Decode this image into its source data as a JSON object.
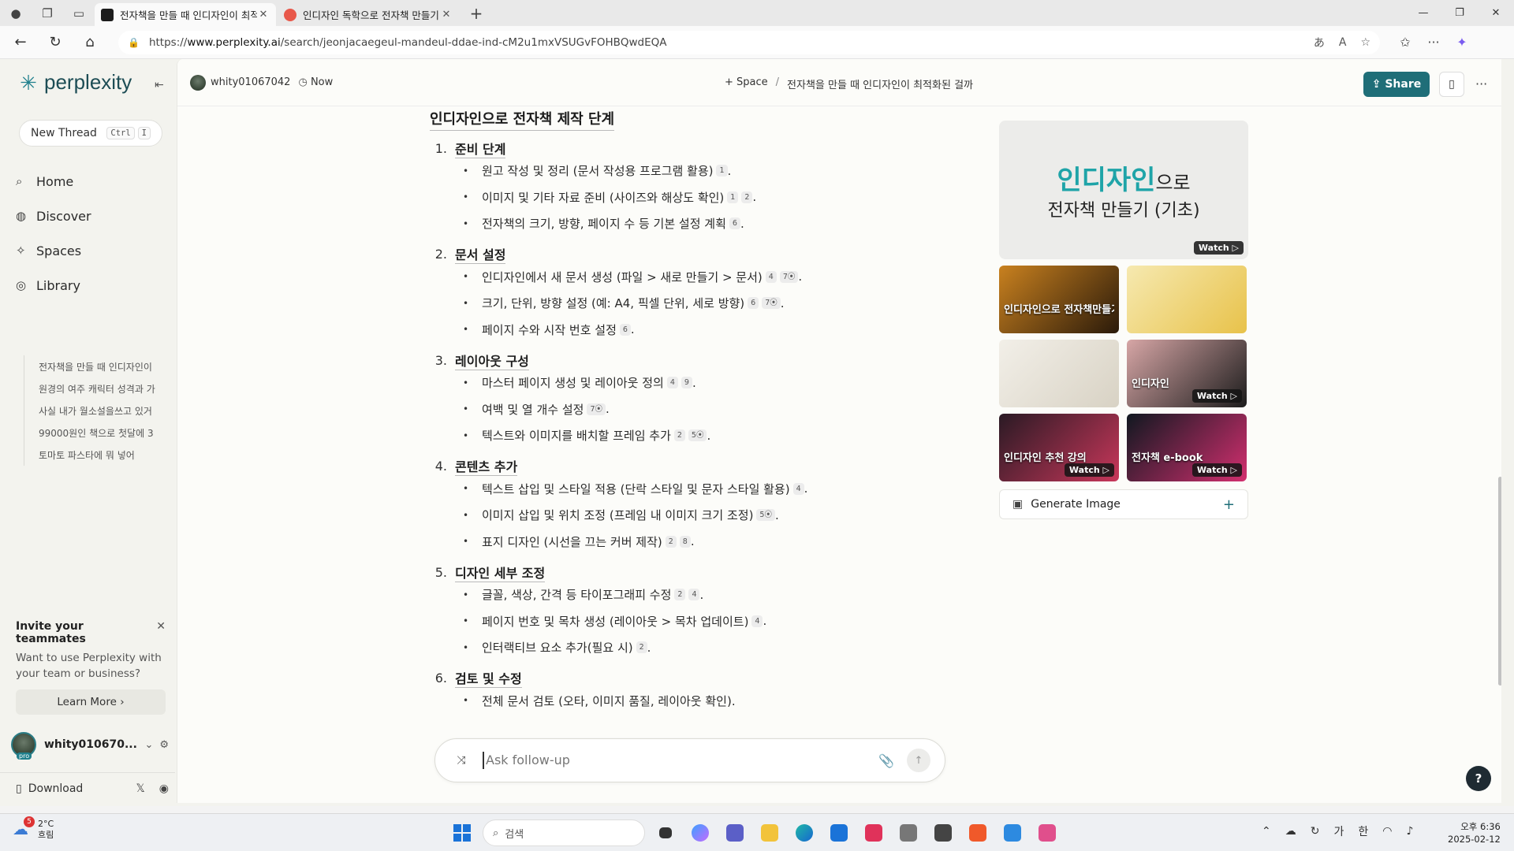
{
  "browser": {
    "tabs": [
      {
        "title": "전자책을 만들 때 인디자인이 최적화된 걸까",
        "active": true
      },
      {
        "title": "인디자인 독학으로 전자책 만들기",
        "active": false
      }
    ],
    "url_prefix": "https://",
    "url_host": "www.perplexity.ai",
    "url_path": "/search/jeonjacaegeul-mandeul-ddae-ind-cM2u1mxVSUGvFOHBQwdEQA"
  },
  "sidebar": {
    "logo": "perplexity",
    "new_thread": "New Thread",
    "shortcut_ctrl": "Ctrl",
    "shortcut_key": "I",
    "nav": [
      {
        "label": "Home",
        "icon": "search-icon"
      },
      {
        "label": "Discover",
        "icon": "globe-icon"
      },
      {
        "label": "Spaces",
        "icon": "spaces-icon"
      },
      {
        "label": "Library",
        "icon": "library-icon"
      }
    ],
    "library": [
      "전자책을 만들 때 인디자인이",
      "원경의 여주 캐릭터 성격과 가",
      "사실 내가 월소설을쓰고 있거",
      "99000원인 책으로 첫달에 3",
      "토마토 파스타에 뭐 넣어"
    ],
    "invite": {
      "title": "Invite your teammates",
      "body": "Want to use Perplexity with your team or business?",
      "button": "Learn More"
    },
    "user": "whity010670...",
    "pro_badge": "pro",
    "download": "Download"
  },
  "topbar": {
    "user": "whity01067042",
    "time": "Now",
    "space": "Space",
    "thread_title": "전자책을 만들 때 인디자인이 최적화된 걸까",
    "share": "Share"
  },
  "article": {
    "title": "인디자인으로 전자책 제작 단계",
    "steps": [
      {
        "num": "1.",
        "title": "준비 단계",
        "items": [
          {
            "text": "원고 작성 및 정리 (문서 작성용 프로그램 활용)",
            "cites": [
              "1"
            ]
          },
          {
            "text": "이미지 및 기타 자료 준비 (사이즈와 해상도 확인)",
            "cites": [
              "1",
              "2"
            ]
          },
          {
            "text": "전자책의 크기, 방향, 페이지 수 등 기본 설정 계획",
            "cites": [
              "6"
            ]
          }
        ]
      },
      {
        "num": "2.",
        "title": "문서 설정",
        "items": [
          {
            "text": "인디자인에서 새 문서 생성 (파일 > 새로 만들기 > 문서)",
            "cites": [
              "4",
              "7⦿"
            ]
          },
          {
            "text": "크기, 단위, 방향 설정 (예: A4, 픽셀 단위, 세로 방향)",
            "cites": [
              "6",
              "7⦿"
            ]
          },
          {
            "text": "페이지 수와 시작 번호 설정",
            "cites": [
              "6"
            ]
          }
        ]
      },
      {
        "num": "3.",
        "title": "레이아웃 구성",
        "items": [
          {
            "text": "마스터 페이지 생성 및 레이아웃 정의",
            "cites": [
              "4",
              "9"
            ]
          },
          {
            "text": "여백 및 열 개수 설정",
            "cites": [
              "7⦿"
            ]
          },
          {
            "text": "텍스트와 이미지를 배치할 프레임 추가",
            "cites": [
              "2",
              "5⦿"
            ]
          }
        ]
      },
      {
        "num": "4.",
        "title": "콘텐츠 추가",
        "items": [
          {
            "text": "텍스트 삽입 및 스타일 적용 (단락 스타일 및 문자 스타일 활용)",
            "cites": [
              "4"
            ]
          },
          {
            "text": "이미지 삽입 및 위치 조정 (프레임 내 이미지 크기 조정)",
            "cites": [
              "5⦿"
            ]
          },
          {
            "text": "표지 디자인 (시선을 끄는 커버 제작)",
            "cites": [
              "2",
              "8"
            ]
          }
        ]
      },
      {
        "num": "5.",
        "title": "디자인 세부 조정",
        "items": [
          {
            "text": "글꼴, 색상, 간격 등 타이포그래피 수정",
            "cites": [
              "2",
              "4"
            ]
          },
          {
            "text": "페이지 번호 및 목차 생성 (레이아웃 > 목차 업데이트)",
            "cites": [
              "4"
            ]
          },
          {
            "text": "인터랙티브 요소 추가(필요 시)",
            "cites": [
              "2"
            ]
          }
        ]
      },
      {
        "num": "6.",
        "title": "검토 및 수정",
        "items": [
          {
            "text": "전체 문서 검토 (오타, 이미지 품질, 레이아웃 확인).",
            "cites": []
          }
        ]
      }
    ]
  },
  "media": {
    "hero_line1_main": "인디자인",
    "hero_line1_suffix": "으로",
    "hero_line2": "전자책 만들기 (기초)",
    "watch": "Watch",
    "thumbs": [
      {
        "colors": [
          "#c9811f",
          "#2a1a0a"
        ],
        "caption": "인디자인으로 전자책만들기",
        "watch": false
      },
      {
        "colors": [
          "#f6e9b0",
          "#e8c24a"
        ],
        "caption": "",
        "watch": false
      },
      {
        "colors": [
          "#f2efe8",
          "#d8d2c4"
        ],
        "caption": "",
        "watch": false
      },
      {
        "colors": [
          "#d7a6a6",
          "#1c1c1c"
        ],
        "caption": "인디자인",
        "watch": true
      },
      {
        "colors": [
          "#2a1a24",
          "#c8375a"
        ],
        "caption": "인디자인 추천 강의",
        "watch": true
      },
      {
        "colors": [
          "#101820",
          "#d32f6f"
        ],
        "caption": "전자책 e-book",
        "watch": true
      }
    ],
    "generate_image": "Generate Image"
  },
  "followup": {
    "placeholder": "Ask follow-up"
  },
  "taskbar": {
    "temp": "2°C",
    "weather": "흐림",
    "weather_badge": "5",
    "search": "검색",
    "ime1": "가",
    "ime2": "한",
    "time": "오후 6:36",
    "date": "2025-02-12"
  }
}
